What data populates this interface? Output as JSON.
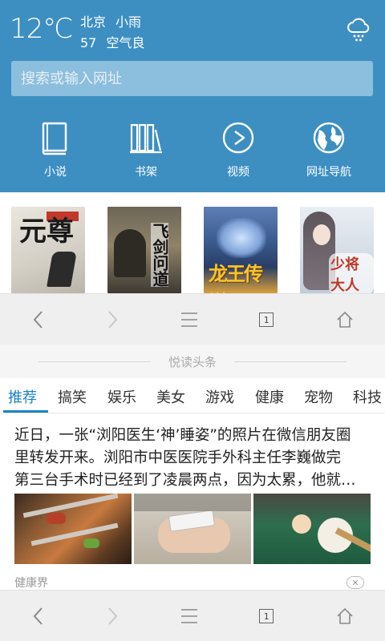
{
  "weather": {
    "temperature": "12℃",
    "city": "北京",
    "condition": "小雨",
    "aqi": "57",
    "air_quality": "空气良",
    "icon": "cloud-rain-icon"
  },
  "search": {
    "placeholder": "搜索或输入网址"
  },
  "shortcuts": [
    {
      "label": "小说",
      "icon": "book-icon"
    },
    {
      "label": "书架",
      "icon": "bookshelf-icon"
    },
    {
      "label": "视频",
      "icon": "play-icon"
    },
    {
      "label": "网址导航",
      "icon": "globe-icon"
    }
  ],
  "book_covers": [
    {
      "title": "元尊"
    },
    {
      "title": "飞剑问道"
    },
    {
      "title": "龙王传说"
    },
    {
      "title": "少将大人"
    }
  ],
  "toolbar": {
    "icons": [
      "back-icon",
      "forward-icon",
      "menu-icon",
      "tabs-icon",
      "home-icon"
    ],
    "tab_count": "1"
  },
  "news": {
    "section_title": "悦读头条",
    "categories": [
      "推荐",
      "搞笑",
      "娱乐",
      "美女",
      "游戏",
      "健康",
      "宠物",
      "科技"
    ],
    "active_category": "推荐",
    "article": {
      "lines": [
        "近日，一张“浏阳医生‘神’睡姿”的照片在微信朋友圈",
        "里转发开来。浏阳市中医医院手外科主任李巍做完",
        "第三台手术时已经到了凌晨两点，因为太累，他就…"
      ],
      "source": "健康界",
      "close_label": "✕"
    }
  },
  "colors": {
    "header_bg": "#3d8fc2",
    "accent": "#1c83c6"
  }
}
